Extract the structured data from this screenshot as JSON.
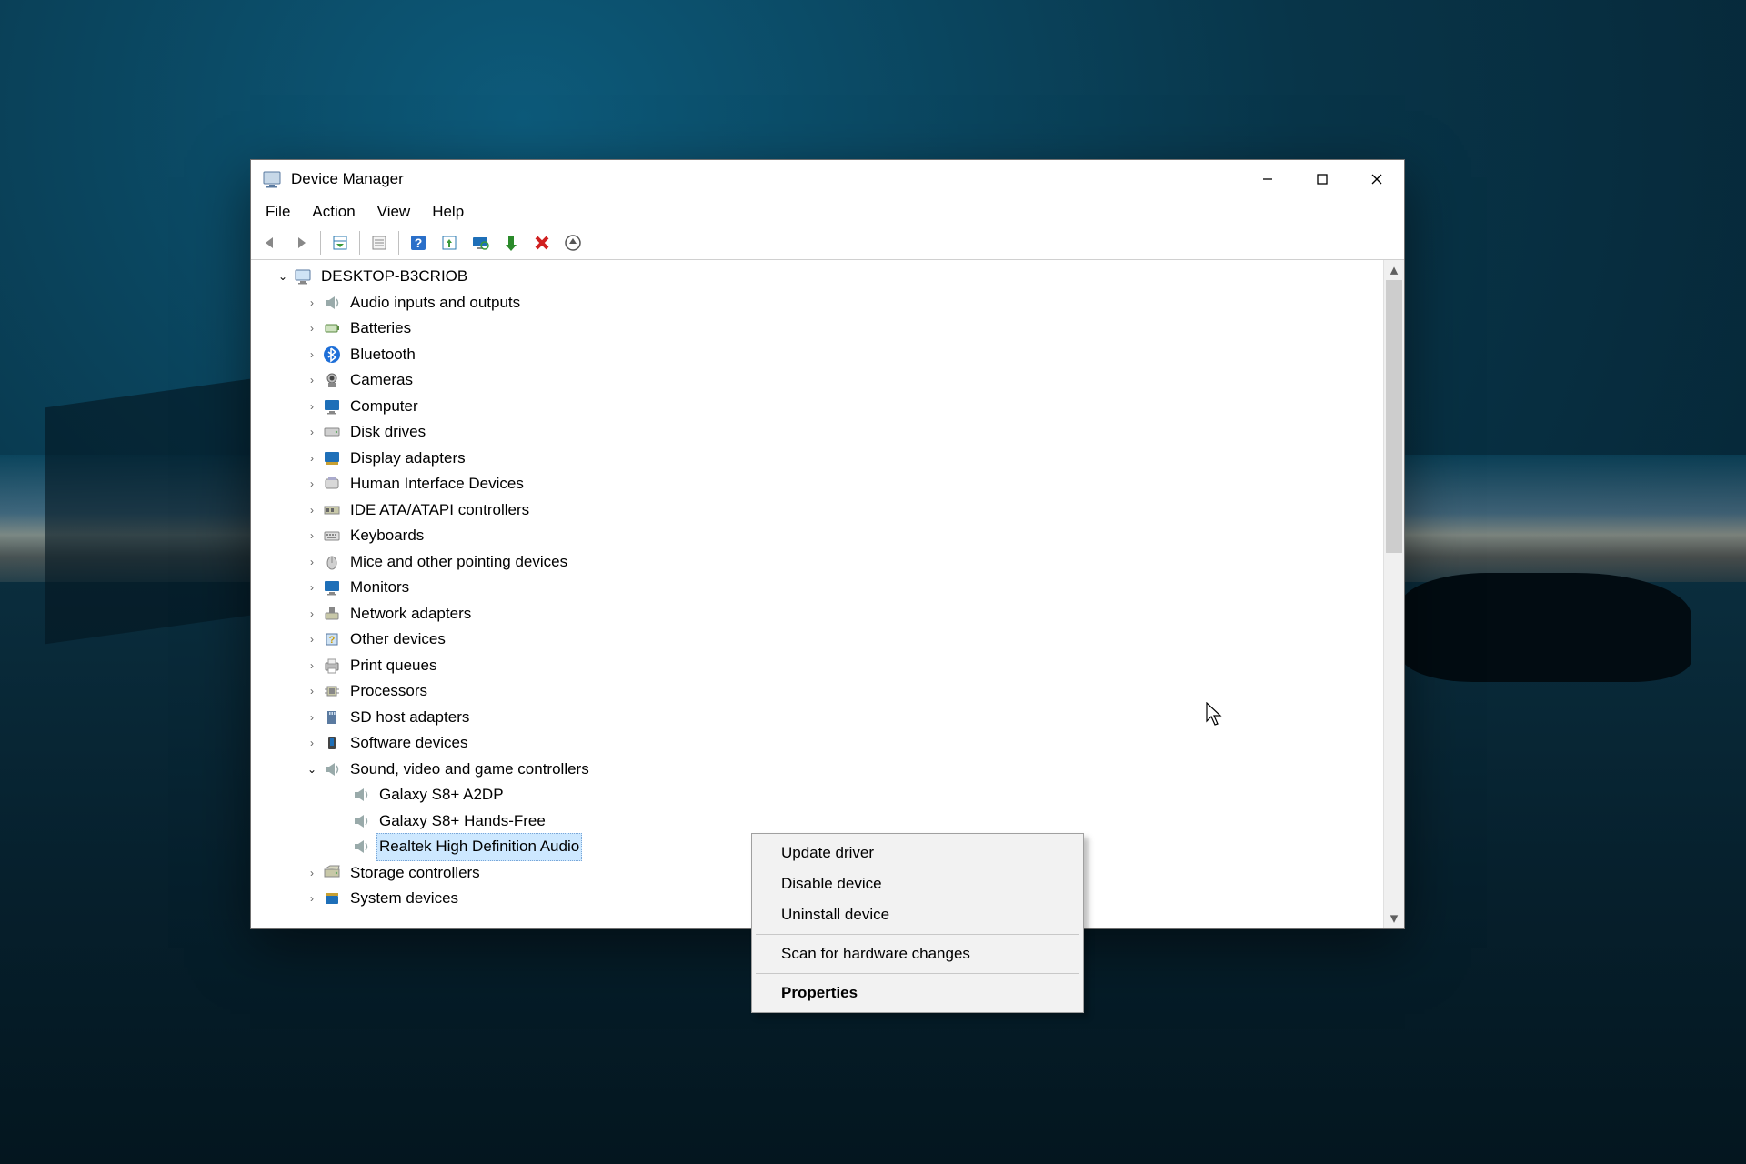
{
  "window": {
    "title": "Device Manager",
    "menus": [
      "File",
      "Action",
      "View",
      "Help"
    ],
    "toolbar_icons": [
      "back",
      "forward",
      "|",
      "show-hidden",
      "|",
      "properties",
      "|",
      "help",
      "update",
      "monitor-scan",
      "enable",
      "uninstall",
      "scan-hardware"
    ]
  },
  "tree": {
    "root": "DESKTOP-B3CRIOB",
    "categories": [
      {
        "label": "Audio inputs and outputs",
        "icon": "speaker"
      },
      {
        "label": "Batteries",
        "icon": "battery"
      },
      {
        "label": "Bluetooth",
        "icon": "bluetooth"
      },
      {
        "label": "Cameras",
        "icon": "camera"
      },
      {
        "label": "Computer",
        "icon": "monitor"
      },
      {
        "label": "Disk drives",
        "icon": "disk"
      },
      {
        "label": "Display adapters",
        "icon": "display-adapter"
      },
      {
        "label": "Human Interface Devices",
        "icon": "hid"
      },
      {
        "label": "IDE ATA/ATAPI controllers",
        "icon": "ide"
      },
      {
        "label": "Keyboards",
        "icon": "keyboard"
      },
      {
        "label": "Mice and other pointing devices",
        "icon": "mouse"
      },
      {
        "label": "Monitors",
        "icon": "monitor"
      },
      {
        "label": "Network adapters",
        "icon": "network"
      },
      {
        "label": "Other devices",
        "icon": "other"
      },
      {
        "label": "Print queues",
        "icon": "printer"
      },
      {
        "label": "Processors",
        "icon": "cpu"
      },
      {
        "label": "SD host adapters",
        "icon": "sd"
      },
      {
        "label": "Software devices",
        "icon": "software"
      },
      {
        "label": "Sound, video and game controllers",
        "icon": "speaker",
        "expanded": true,
        "children": [
          {
            "label": "Galaxy S8+ A2DP",
            "icon": "speaker"
          },
          {
            "label": "Galaxy S8+ Hands-Free",
            "icon": "speaker"
          },
          {
            "label": "Realtek High Definition Audio",
            "icon": "speaker",
            "selected": true
          }
        ]
      },
      {
        "label": "Storage controllers",
        "icon": "storage"
      },
      {
        "label": "System devices",
        "icon": "system"
      }
    ]
  },
  "context_menu": {
    "items": [
      {
        "label": "Update driver"
      },
      {
        "label": "Disable device"
      },
      {
        "label": "Uninstall device"
      },
      {
        "sep": true
      },
      {
        "label": "Scan for hardware changes"
      },
      {
        "sep": true
      },
      {
        "label": "Properties",
        "bold": true
      }
    ]
  }
}
